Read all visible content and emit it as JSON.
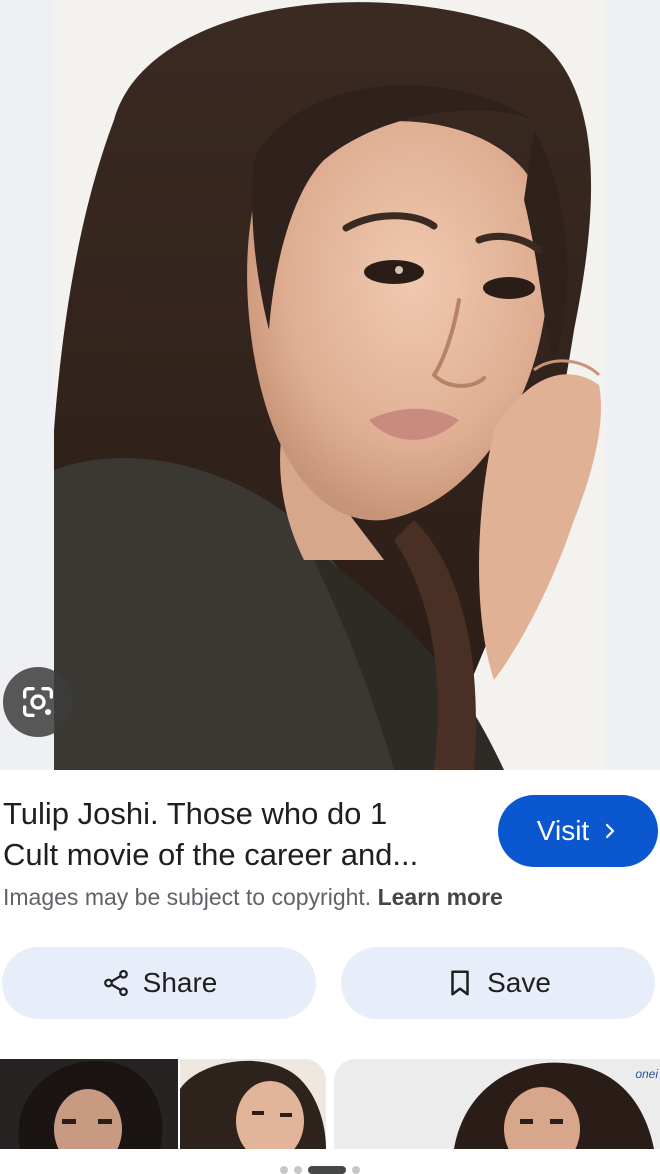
{
  "result": {
    "title_line1": "Tulip Joshi. Those who do 1",
    "title_line2": "Cult movie of the career and...",
    "visit_label": "Visit",
    "copyright_text": "Images may be subject to copyright.",
    "learn_more": "Learn more"
  },
  "actions": {
    "share_label": "Share",
    "save_label": "Save"
  },
  "thumbnails": {
    "brand_tag": "onei"
  },
  "icons": {
    "lens": "google-lens-icon",
    "visit": "chevron-right-icon",
    "share": "share-icon",
    "save": "bookmark-icon"
  },
  "colors": {
    "accent": "#0b57d0",
    "pill_bg": "#e8eef9",
    "muted_text": "#5f6368"
  }
}
